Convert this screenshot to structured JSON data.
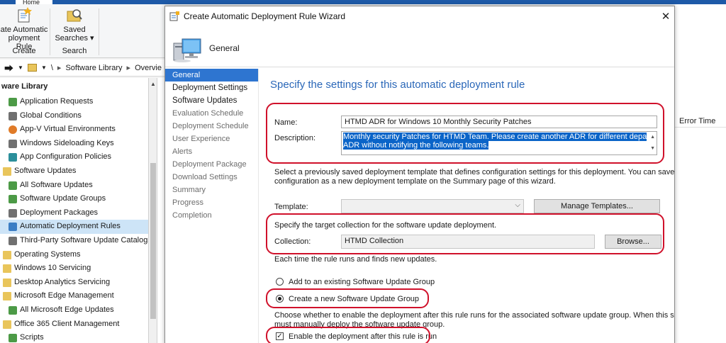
{
  "ribbon": {
    "tab_home": "Home",
    "create_adr_label": "Create Automatic Deployment Rule",
    "create_adr_line1": "ate Automatic",
    "create_adr_line2": "ployment Rule",
    "saved_searches_line1": "Saved",
    "saved_searches_line2": "Searches ▾",
    "group_create": "Create",
    "group_search": "Search"
  },
  "navbar": {
    "path_sep": "\\",
    "crumb1": "Software Library",
    "crumb2": "Overvie"
  },
  "left_panel": {
    "title": "ware Library",
    "items": [
      {
        "label": "Application Requests",
        "level": 1,
        "icon": "green"
      },
      {
        "label": "Global Conditions",
        "level": 1,
        "icon": "gray"
      },
      {
        "label": "App-V Virtual Environments",
        "level": 1,
        "icon": "orange"
      },
      {
        "label": "Windows Sideloading Keys",
        "level": 1,
        "icon": "gray"
      },
      {
        "label": "App Configuration Policies",
        "level": 1,
        "icon": "teal"
      },
      {
        "label": "Software Updates",
        "level": 0,
        "icon": "folder"
      },
      {
        "label": "All Software Updates",
        "level": 1,
        "icon": "green"
      },
      {
        "label": "Software Update Groups",
        "level": 1,
        "icon": "green"
      },
      {
        "label": "Deployment Packages",
        "level": 1,
        "icon": "gray"
      },
      {
        "label": "Automatic Deployment Rules",
        "level": 1,
        "icon": "blue",
        "selected": true
      },
      {
        "label": "Third-Party Software Update Catalogs",
        "level": 1,
        "icon": "gray"
      },
      {
        "label": "Operating Systems",
        "level": 0,
        "icon": "folder"
      },
      {
        "label": "Windows 10 Servicing",
        "level": 0,
        "icon": "folder"
      },
      {
        "label": "Desktop Analytics Servicing",
        "level": 0,
        "icon": "folder"
      },
      {
        "label": "Microsoft Edge Management",
        "level": 0,
        "icon": "folder"
      },
      {
        "label": "All Microsoft Edge Updates",
        "level": 1,
        "icon": "green"
      },
      {
        "label": "Office 365 Client Management",
        "level": 0,
        "icon": "folder"
      },
      {
        "label": "Scripts",
        "level": 1,
        "icon": "green"
      }
    ]
  },
  "background_list": {
    "col_error_time": "Error Time"
  },
  "wizard": {
    "title": "Create Automatic Deployment Rule Wizard",
    "close_glyph": "✕",
    "header_title": "General",
    "steps": [
      {
        "label": "General",
        "state": "current"
      },
      {
        "label": "Deployment Settings",
        "state": "bold"
      },
      {
        "label": "Software Updates",
        "state": "bold"
      },
      {
        "label": "Evaluation Schedule",
        "state": "normal"
      },
      {
        "label": "Deployment Schedule",
        "state": "normal"
      },
      {
        "label": "User Experience",
        "state": "normal"
      },
      {
        "label": "Alerts",
        "state": "normal"
      },
      {
        "label": "Deployment Package",
        "state": "normal"
      },
      {
        "label": "Download Settings",
        "state": "normal"
      },
      {
        "label": "Summary",
        "state": "normal"
      },
      {
        "label": "Progress",
        "state": "normal"
      },
      {
        "label": "Completion",
        "state": "normal"
      }
    ],
    "heading": "Specify the settings for this automatic deployment rule",
    "name_label": "Name:",
    "name_value": "HTMD ADR for Windows 10 Monthly Security Patches",
    "description_label": "Description:",
    "description_line1": "Monthly security Patches for HTMD Team. Please create another ADR for different departs. Don't change the",
    "description_line2": "ADR without notifying the following teams.",
    "template_info_line1": "Select a previously saved deployment template that defines configuration settings for this deployment. You can save the current",
    "template_info_line2": "configuration as a new deployment template on the Summary page of this wizard.",
    "template_label": "Template:",
    "template_value": "",
    "manage_templates_button": "Manage Templates...",
    "collection_info": "Specify the target collection for the software update deployment.",
    "collection_label": "Collection:",
    "collection_value": "HTMD Collection",
    "browse_button": "Browse...",
    "rule_run_info": "Each time the rule runs and finds new updates.",
    "radio_existing_group": "Add to an existing Software Update Group",
    "radio_new_group": "Create a new Software Update Group",
    "enable_info_line1": "Choose whether to enable the deployment after this rule runs for the associated software update group. When this setting is not selected, you",
    "enable_info_line2": "must manually deploy the software update group.",
    "enable_checkbox_label": "Enable the deployment after this rule is run",
    "check_glyph": "✓"
  },
  "colors": {
    "accent": "#2e75d0",
    "heading": "#2a67b8",
    "annotation_ring": "#d0112b"
  }
}
